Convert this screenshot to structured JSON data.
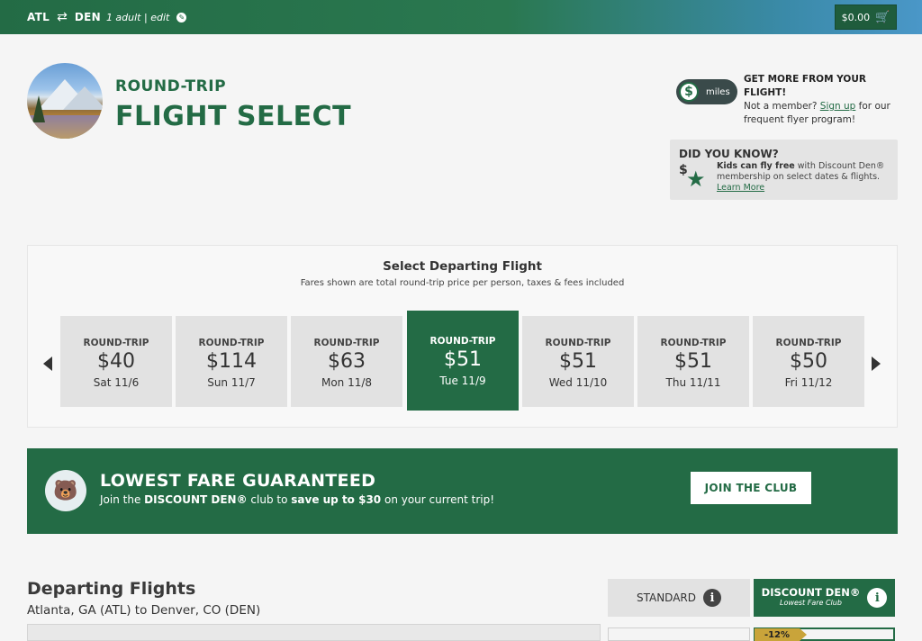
{
  "topbar": {
    "origin": "ATL",
    "swap_glyph": "⇄",
    "destination": "DEN",
    "passengers": "1 adult | edit",
    "edit_icon": "✎",
    "cart_total": "$0.00",
    "cart_icon": "🛒"
  },
  "hero": {
    "subtitle": "ROUND-TRIP",
    "title": "FLIGHT SELECT"
  },
  "miles_promo": {
    "toggle_symbol": "$",
    "toggle_label": "miles",
    "heading": "GET MORE FROM YOUR FLIGHT!",
    "text_before": "Not a member? ",
    "link": "Sign up",
    "text_after": " for our frequent flyer program!"
  },
  "did_you_know": {
    "heading": "DID YOU KNOW?",
    "icon_symbol": "$",
    "icon_star": "★",
    "bold": "Kids can fly free",
    "text": " with Discount Den® membership on select dates & flights.",
    "link": "Learn More"
  },
  "date_selector": {
    "title": "Select Departing Flight",
    "subtitle": "Fares shown are total round-trip price per person, taxes & fees included",
    "selected_index": 3,
    "days": [
      {
        "type": "ROUND-TRIP",
        "price": "$40",
        "date": "Sat 11/6"
      },
      {
        "type": "ROUND-TRIP",
        "price": "$114",
        "date": "Sun 11/7"
      },
      {
        "type": "ROUND-TRIP",
        "price": "$63",
        "date": "Mon 11/8"
      },
      {
        "type": "ROUND-TRIP",
        "price": "$51",
        "date": "Tue 11/9"
      },
      {
        "type": "ROUND-TRIP",
        "price": "$51",
        "date": "Wed 11/10"
      },
      {
        "type": "ROUND-TRIP",
        "price": "$51",
        "date": "Thu 11/11"
      },
      {
        "type": "ROUND-TRIP",
        "price": "$50",
        "date": "Fri 11/12"
      }
    ]
  },
  "banner": {
    "heading": "LOWEST FARE GUARANTEED",
    "text_1": "Join the ",
    "bold_1": "DISCOUNT DEN®",
    "text_2": " club to ",
    "bold_2": "save up to $30",
    "text_3": " on your current trip!",
    "button": "JOIN THE CLUB",
    "mascot_icon": "🐻"
  },
  "departing": {
    "title": "Departing Flights",
    "route": "Atlanta, GA (ATL) to Denver, CO (DEN)",
    "tab_standard": "STANDARD",
    "tab_dd_title": "DISCOUNT DEN®",
    "tab_dd_sub": "Lowest Fare Club",
    "info_glyph": "i",
    "discount_badge": "-12%"
  },
  "colors": {
    "brand_green": "#236b45",
    "gradient_end": "#4a97c8",
    "badge_gold": "#c9a43a"
  }
}
